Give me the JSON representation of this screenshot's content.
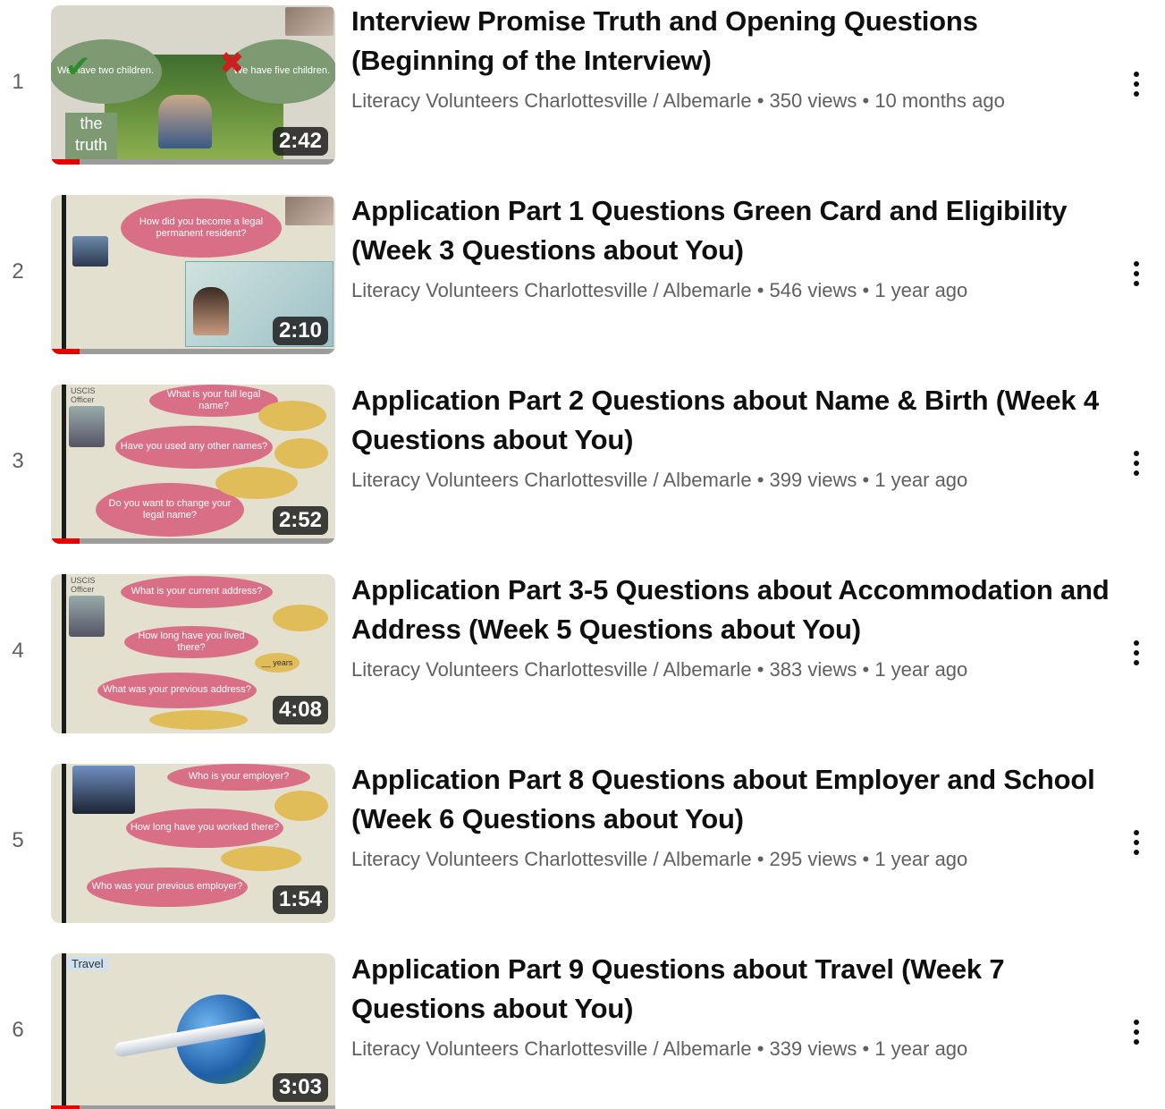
{
  "separator": "•",
  "videos": [
    {
      "index": "1",
      "title": "Interview Promise Truth and Opening Questions (Beginning of the Interview)",
      "channel": "Literacy Volunteers Charlottesville / Albemarle",
      "views": "350 views",
      "age": "10 months ago",
      "duration": "2:42",
      "watched_fraction": 0.1,
      "thumb_text": [
        "We have two children.",
        "We have five children.",
        "the truth"
      ]
    },
    {
      "index": "2",
      "title": "Application Part 1 Questions Green Card and Eligibility (Week 3 Questions about You)",
      "channel": "Literacy Volunteers Charlottesville / Albemarle",
      "views": "546 views",
      "age": "1 year ago",
      "duration": "2:10",
      "watched_fraction": 0.1,
      "thumb_text": [
        "How did you become a legal permanent resident?"
      ]
    },
    {
      "index": "3",
      "title": "Application Part 2 Questions about Name & Birth (Week 4 Questions about You)",
      "channel": "Literacy Volunteers Charlottesville / Albemarle",
      "views": "399 views",
      "age": "1 year ago",
      "duration": "2:52",
      "watched_fraction": 0.1,
      "thumb_text": [
        "What is your full legal name?",
        "Have you used any other names?",
        "Do you want to change your legal name?",
        "USCIS Officer"
      ]
    },
    {
      "index": "4",
      "title": "Application Part 3-5 Questions about Accommodation and Address (Week 5 Questions about You)",
      "channel": "Literacy Volunteers Charlottesville / Albemarle",
      "views": "383 views",
      "age": "1 year ago",
      "duration": "4:08",
      "watched_fraction": 0,
      "thumb_text": [
        "What is your current address?",
        "How long have you lived there?",
        "What was your previous address?",
        "__ years",
        "USCIS Officer"
      ]
    },
    {
      "index": "5",
      "title": "Application Part 8 Questions about Employer and School (Week 6 Questions about You)",
      "channel": "Literacy Volunteers Charlottesville / Albemarle",
      "views": "295 views",
      "age": "1 year ago",
      "duration": "1:54",
      "watched_fraction": 0,
      "thumb_text": [
        "Who is your employer?",
        "How long have you worked there?",
        "Who was your previous employer?"
      ]
    },
    {
      "index": "6",
      "title": "Application Part 9 Questions about Travel (Week 7 Questions about You)",
      "channel": "Literacy Volunteers Charlottesville / Albemarle",
      "views": "339 views",
      "age": "1 year ago",
      "duration": "3:03",
      "watched_fraction": 0.1,
      "thumb_text": [
        "Travel"
      ]
    }
  ],
  "colors": {
    "progress": "#e60000",
    "meta": "#606060",
    "title": "#0f0f0f"
  }
}
